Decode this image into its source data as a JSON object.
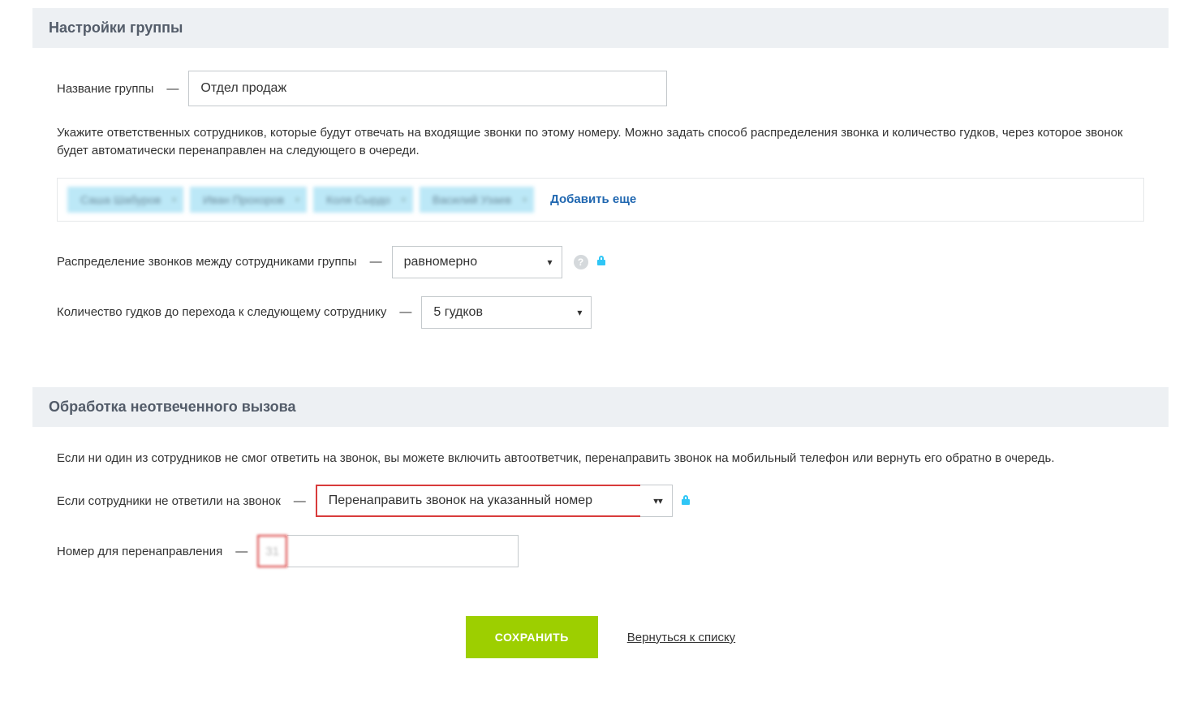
{
  "section1": {
    "title": "Настройки группы",
    "group_name_label": "Название группы",
    "group_name_value": "Отдел продаж",
    "description": "Укажите ответственных сотрудников, которые будут отвечать на входящие звонки по этому номеру. Можно задать способ распределения звонка и количество гудков, через которое звонок будет автоматически перенаправлен на следующего в очереди.",
    "tags": [
      "Саша Шабуров",
      "Иван Прохоров",
      "Коля Сырдо",
      "Василий Узаев"
    ],
    "add_more": "Добавить еще",
    "distribution_label": "Распределение звонков между сотрудниками группы",
    "distribution_value": "равномерно",
    "rings_label": "Количество гудков до перехода к следующему сотруднику",
    "rings_value": "5 гудков"
  },
  "section2": {
    "title": "Обработка неотвеченного вызова",
    "description": "Если ни один из сотрудников не смог ответить на звонок, вы можете включить автоответчик, перенаправить звонок на мобильный телефон или вернуть его обратно в очередь.",
    "noanswer_label": "Если сотрудники не ответили на звонок",
    "noanswer_value": "Перенаправить звонок на указанный номер",
    "forward_label": "Номер для перенаправления",
    "forward_prefix": "31",
    "forward_value": ""
  },
  "buttons": {
    "save": "СОХРАНИТЬ",
    "back": "Вернуться к списку"
  }
}
